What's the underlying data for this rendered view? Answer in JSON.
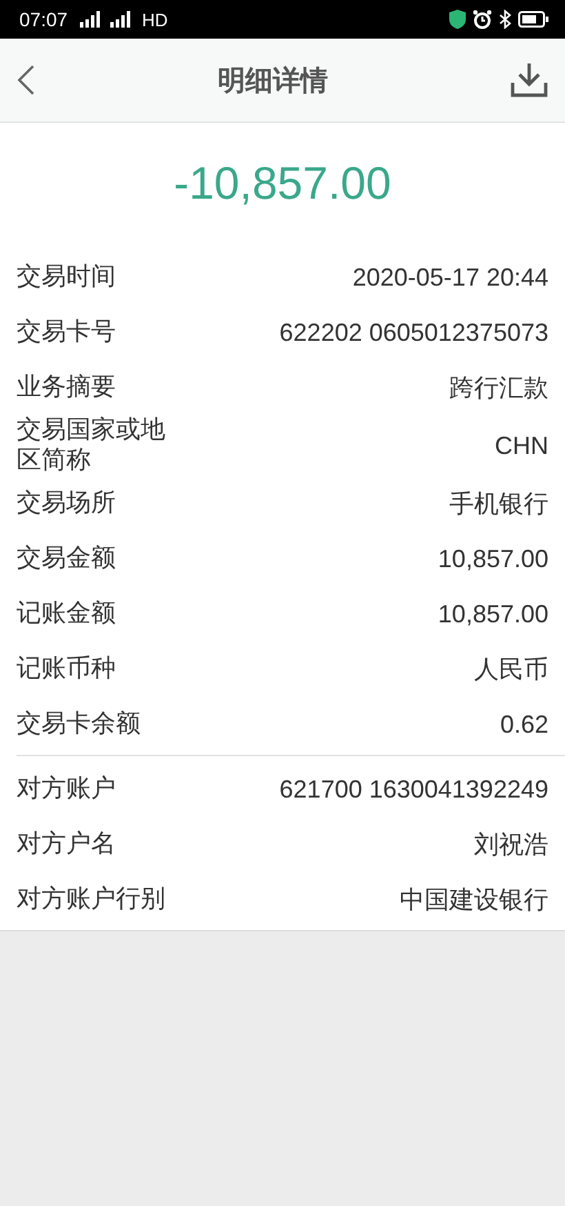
{
  "status_bar": {
    "time": "07:07",
    "network": "HD"
  },
  "header": {
    "title": "明细详情"
  },
  "amount": "-10,857.00",
  "groups": [
    {
      "rows": [
        {
          "label": "交易时间",
          "value": "2020-05-17 20:44"
        },
        {
          "label": "交易卡号",
          "value": "622202 0605012375073"
        },
        {
          "label": "业务摘要",
          "value": "跨行汇款"
        },
        {
          "label": "交易国家或地区简称",
          "value": "CHN"
        },
        {
          "label": "交易场所",
          "value": "手机银行"
        },
        {
          "label": "交易金额",
          "value": "10,857.00"
        },
        {
          "label": "记账金额",
          "value": "10,857.00"
        },
        {
          "label": "记账币种",
          "value": "人民币"
        },
        {
          "label": "交易卡余额",
          "value": "0.62"
        }
      ]
    },
    {
      "rows": [
        {
          "label": "对方账户",
          "value": "621700 1630041392249"
        },
        {
          "label": "对方户名",
          "value": "刘祝浩"
        },
        {
          "label": "对方账户行别",
          "value": "中国建设银行"
        }
      ]
    }
  ]
}
